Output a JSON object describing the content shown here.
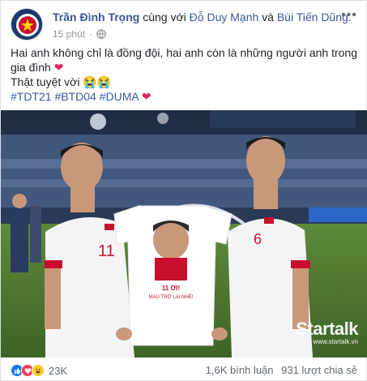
{
  "post": {
    "author": "Trần Đình Trọng",
    "with_text": "cùng với",
    "tagged_1": "Đỗ Duy Mạnh",
    "and_text": "và",
    "tagged_2": "Bùi Tiến Dũng.",
    "time": "15 phút",
    "separator": "·",
    "body_line1": "Hai anh không chỉ là đồng đội, hai anh còn là những người anh trong gia đình",
    "body_line2": "Thật tuyệt vời",
    "hashtags": "#TDT21 #BTD04 #DUMA",
    "heart": "❤",
    "tears": "😭😭"
  },
  "photo": {
    "shirt_caption_1": "11 ƠI!",
    "shirt_caption_2": "MAU TRỞ LẠI NHÉ!",
    "jersey_left": "11",
    "jersey_right": "6",
    "watermark_brand": "Startalk",
    "watermark_url": "www.startalk.vn"
  },
  "footer": {
    "reaction_count": "23K",
    "comments": "1,6K bình luận",
    "shares": "931 lượt chia sẻ"
  },
  "colors": {
    "link": "#385898",
    "meta": "#90949c",
    "like": "#1877f2",
    "love": "#f33e58"
  },
  "icons": [
    "globe-icon",
    "more-options-icon",
    "like-reaction-icon",
    "love-reaction-icon",
    "haha-reaction-icon"
  ]
}
